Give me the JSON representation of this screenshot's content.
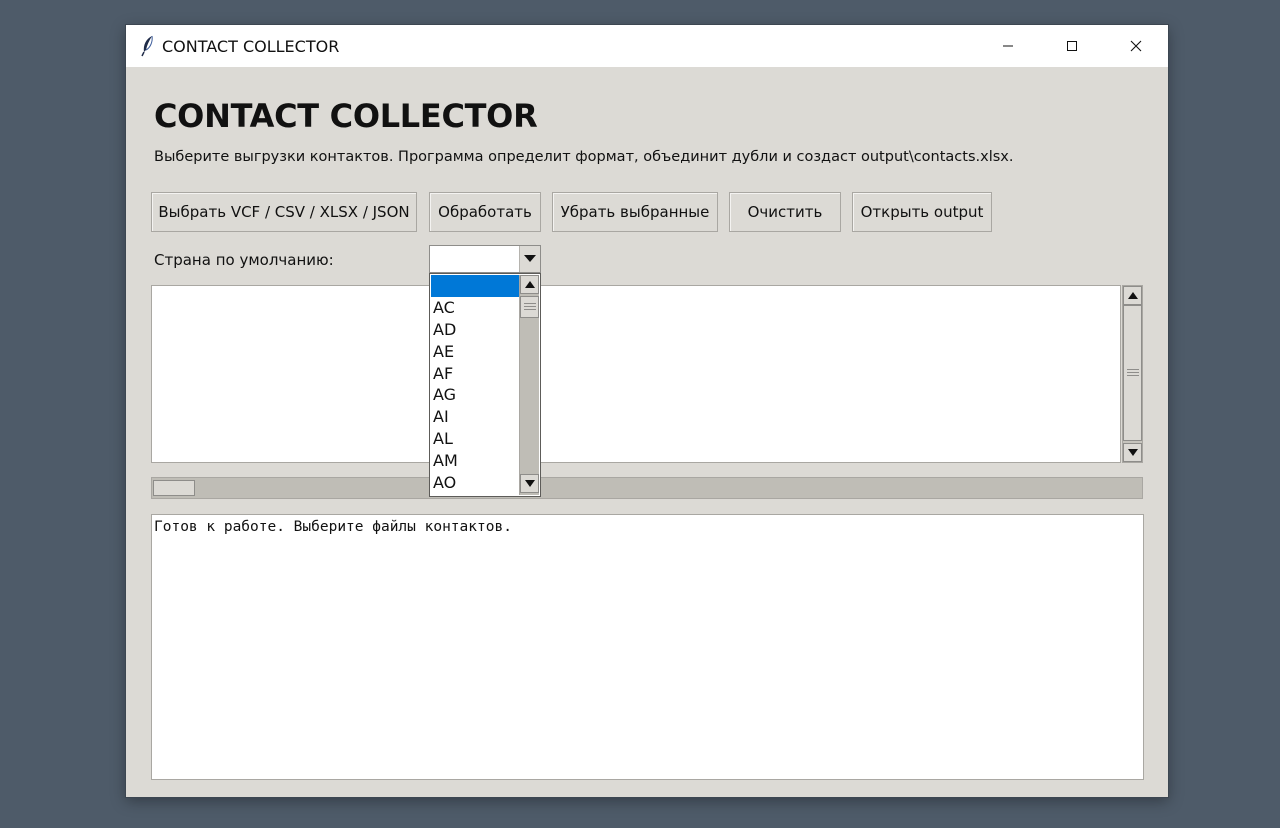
{
  "window": {
    "title": "CONTACT COLLECTOR",
    "icon": "feather-icon"
  },
  "main": {
    "heading": "CONTACT COLLECTOR",
    "subtitle": "Выберите выгрузки контактов. Программа определит формат, объединит дубли и создаст output\\contacts.xlsx."
  },
  "toolbar": {
    "select_label": "Выбрать VCF / CSV / XLSX / JSON",
    "process_label": "Обработать",
    "remove_label": "Убрать выбранные",
    "clear_label": "Очистить",
    "open_output_label": "Открыть output"
  },
  "country": {
    "label": "Страна по умолчанию:",
    "value": "",
    "options": [
      "",
      "AC",
      "AD",
      "AE",
      "AF",
      "AG",
      "AI",
      "AL",
      "AM",
      "AO"
    ],
    "selected_index": 0
  },
  "log": {
    "text": "Готов к работе. Выберите файлы контактов."
  },
  "colors": {
    "window_bg": "#dcdad5",
    "desktop_bg": "#4e5b69",
    "selection": "#0078d7"
  }
}
